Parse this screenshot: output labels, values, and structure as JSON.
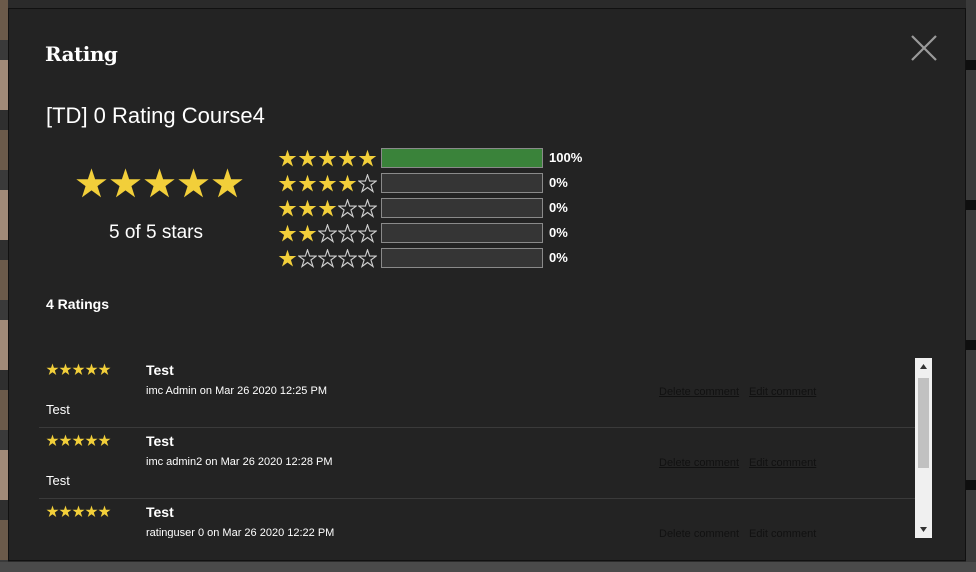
{
  "modal": {
    "title": "Rating",
    "close_icon": "close-icon"
  },
  "course": {
    "title": "[TD] 0 Rating Course4"
  },
  "summary": {
    "average_stars": 5,
    "max_stars": 5,
    "text": "5 of 5 stars",
    "star_color": "#f2cf3a"
  },
  "distribution": [
    {
      "stars": 5,
      "fraction": 1.0,
      "percent": "100%"
    },
    {
      "stars": 4,
      "fraction": 0.0,
      "percent": "0%"
    },
    {
      "stars": 3,
      "fraction": 0.0,
      "percent": "0%"
    },
    {
      "stars": 2,
      "fraction": 0.0,
      "percent": "0%"
    },
    {
      "stars": 1,
      "fraction": 0.0,
      "percent": "0%"
    }
  ],
  "bar_fill_color": "#3a833a",
  "ratings_count": "4 Ratings",
  "comments": [
    {
      "stars": 5,
      "title": "Test",
      "meta": "imc Admin on Mar 26 2020 12:25 PM",
      "body": "Test",
      "delete_label": "Delete comment",
      "edit_label": "Edit comment"
    },
    {
      "stars": 5,
      "title": "Test",
      "meta": "imc admin2 on Mar 26 2020 12:28 PM",
      "body": "Test",
      "delete_label": "Delete comment",
      "edit_label": "Edit comment"
    },
    {
      "stars": 5,
      "title": "Test",
      "meta": "ratinguser 0 on Mar 26 2020 12:22 PM",
      "body": "",
      "delete_label": "Delete comment",
      "edit_label": "Edit comment"
    }
  ]
}
